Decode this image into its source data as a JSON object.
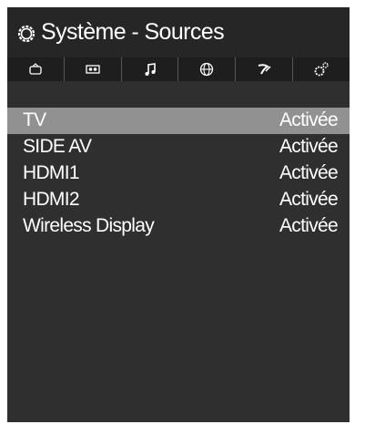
{
  "header": {
    "title": "Système - Sources",
    "icon": "gear-icon"
  },
  "tabs": [
    {
      "name": "tv-tab",
      "icon": "tv-icon",
      "active": false
    },
    {
      "name": "screen-tab",
      "icon": "screen-icon",
      "active": false
    },
    {
      "name": "music-tab",
      "icon": "music-note-icon",
      "active": false
    },
    {
      "name": "internet-tab",
      "icon": "globe-icon",
      "active": false
    },
    {
      "name": "satellite-tab",
      "icon": "satellite-icon",
      "active": false
    },
    {
      "name": "system-tab",
      "icon": "settings-gears-icon",
      "active": true
    }
  ],
  "sources": [
    {
      "name": "TV",
      "status": "Activée",
      "selected": true
    },
    {
      "name": "SIDE AV",
      "status": "Activée",
      "selected": false
    },
    {
      "name": "HDMI1",
      "status": "Activée",
      "selected": false
    },
    {
      "name": "HDMI2",
      "status": "Activée",
      "selected": false
    },
    {
      "name": "Wireless Display",
      "status": "Activée",
      "selected": false
    }
  ],
  "colors": {
    "panel": "#2f2f2f",
    "header": "#262626",
    "tab_bar": "#1e1e1e",
    "selected_row": "#919191",
    "text": "#ffffff"
  }
}
